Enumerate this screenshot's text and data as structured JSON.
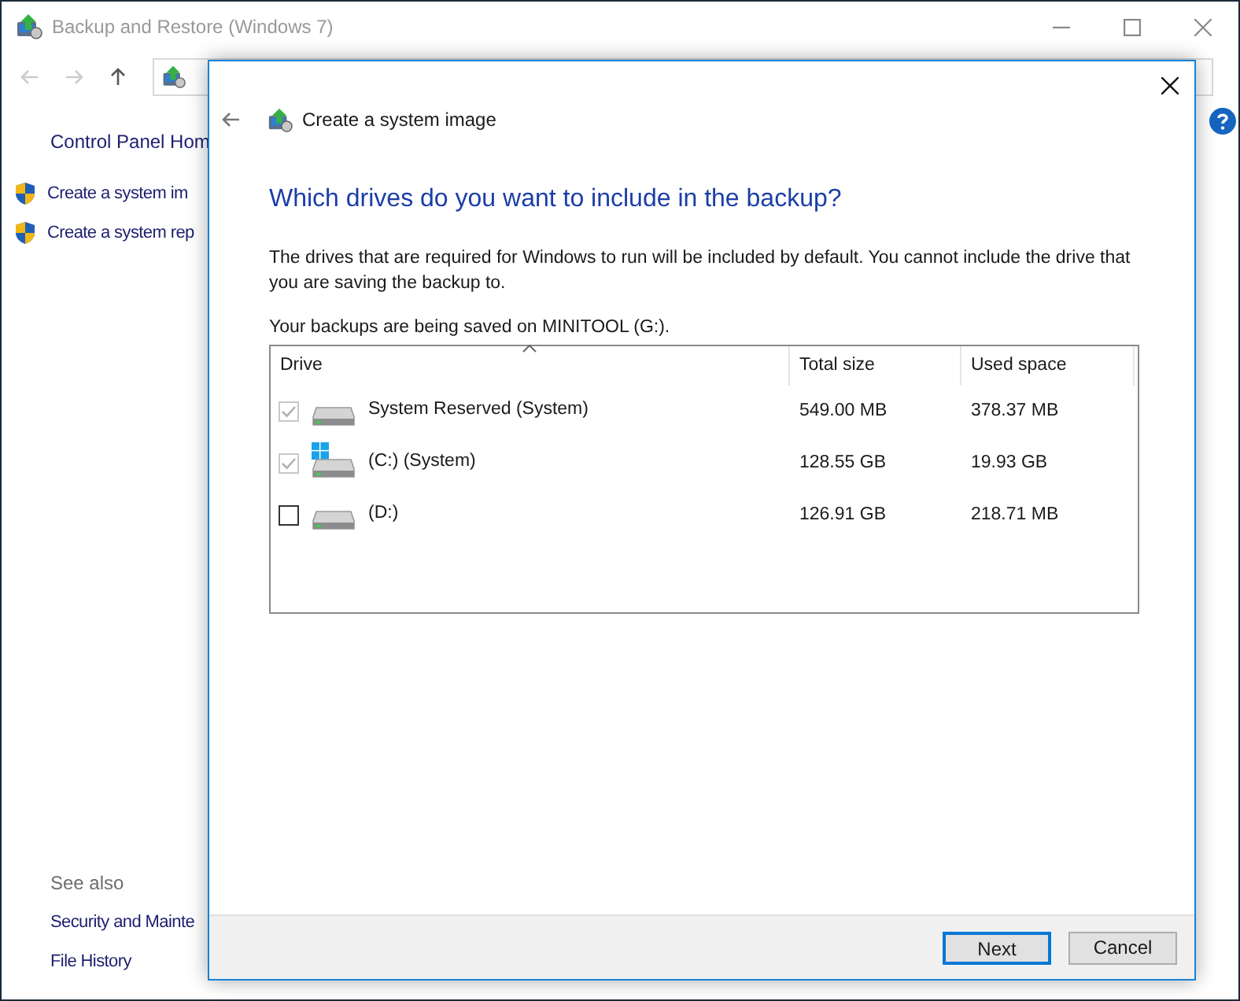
{
  "window": {
    "title": "Backup and Restore (Windows 7)"
  },
  "sidebar": {
    "home_link": "Control Panel Hom",
    "tasks": [
      "Create a system im",
      "Create a system rep"
    ],
    "see_also_heading": "See also",
    "see_also": [
      "Security and Mainte",
      "File History"
    ]
  },
  "dialog": {
    "title": "Create a system image",
    "heading": "Which drives do you want to include in the backup?",
    "description": "The drives that are required for Windows to run will be included by default. You cannot include the drive that you are saving the backup to.",
    "save_location": "Your backups are being saved on MINITOOL (G:).",
    "columns": [
      {
        "label": "Drive",
        "sorted": true
      },
      {
        "label": "Total size",
        "sorted": false
      },
      {
        "label": "Used space",
        "sorted": false
      }
    ],
    "rows": [
      {
        "name": "System Reserved (System)",
        "total": "549.00 MB",
        "used": "378.37 MB",
        "checked": true,
        "disabled": true,
        "windows": false
      },
      {
        "name": "(C:) (System)",
        "total": "128.55 GB",
        "used": "19.93 GB",
        "checked": true,
        "disabled": true,
        "windows": true
      },
      {
        "name": "(D:)",
        "total": "126.91 GB",
        "used": "218.71 MB",
        "checked": false,
        "disabled": false,
        "windows": false
      }
    ],
    "buttons": [
      {
        "label": "Next",
        "default": true
      },
      {
        "label": "Cancel",
        "default": false
      }
    ]
  }
}
